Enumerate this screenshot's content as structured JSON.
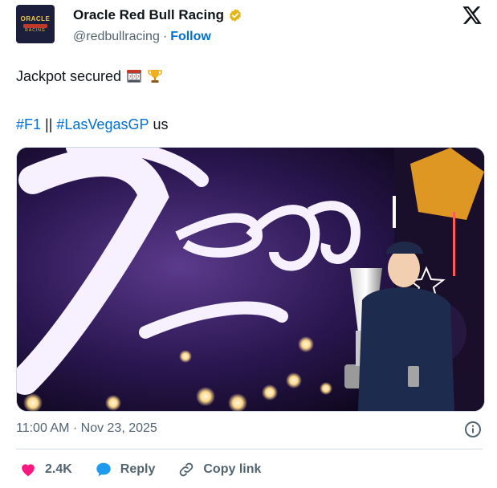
{
  "author": {
    "display_name": "Oracle Red Bull Racing",
    "handle": "@redbullracing",
    "separator": "·",
    "follow_label": "Follow",
    "avatar_text": "ORACLE"
  },
  "tweet": {
    "text_line1": "Jackpot secured",
    "hashtag1": "#F1",
    "separator": "||",
    "hashtag2": "#LasVegasGP",
    "trailing": "us",
    "emojis": [
      "slot-machine-emoji",
      "trophy-emoji"
    ]
  },
  "media": {
    "sign_text": "Vegas"
  },
  "footer": {
    "timestamp": "11:00 AM · Nov 23, 2025",
    "likes_count": "2.4K",
    "reply_label": "Reply",
    "copy_link_label": "Copy link"
  },
  "colors": {
    "link": "#006fd6",
    "like": "#f91880",
    "reply": "#1d9bf0",
    "muted": "#536471",
    "verified": "#e2b719"
  },
  "icons": [
    "x-logo-icon",
    "verified-badge-icon",
    "info-icon",
    "heart-icon",
    "reply-bubble-icon",
    "link-icon"
  ]
}
